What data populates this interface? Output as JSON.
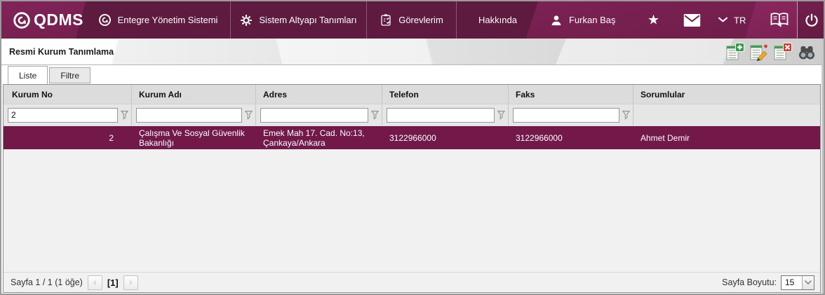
{
  "nav": {
    "logo_text": "QDMS",
    "items": [
      {
        "label": "Entegre Yönetim Sistemi"
      },
      {
        "label": "Sistem Altyapı Tanımları"
      },
      {
        "label": "Görevlerim"
      },
      {
        "label": "Hakkında"
      }
    ],
    "user_name": "Furkan Baş",
    "language": "TR",
    "star_glyph": "★"
  },
  "titlebar": {
    "title": "Resmi Kurum Tanımlama"
  },
  "tabs": {
    "liste": "Liste",
    "filtre": "Filtre"
  },
  "table": {
    "columns": [
      "Kurum No",
      "Kurum Adı",
      "Adres",
      "Telefon",
      "Faks",
      "Sorumlular"
    ],
    "filters": {
      "kurum_no": "2",
      "kurum_adi": "",
      "adres": "",
      "telefon": "",
      "faks": ""
    },
    "row": {
      "kurum_no": "2",
      "kurum_adi": "Çalışma Ve Sosyal Güvenlik Bakanlığı",
      "adres": "Emek Mah 17. Cad. No:13, Çankaya/Ankara",
      "telefon": "3122966000",
      "faks": "3122966000",
      "sorumlular": "Ahmet Demir"
    }
  },
  "pagination": {
    "summary": "Sayfa 1 / 1 (1 öğe)",
    "prev_glyph": "‹",
    "current": "[1]",
    "next_glyph": "›",
    "page_size_label": "Sayfa Boyutu:",
    "page_size_value": "15"
  },
  "colors": {
    "brand_dark": "#5e1a3f",
    "brand_mid": "#7b2153",
    "selected_row": "#72194a"
  }
}
